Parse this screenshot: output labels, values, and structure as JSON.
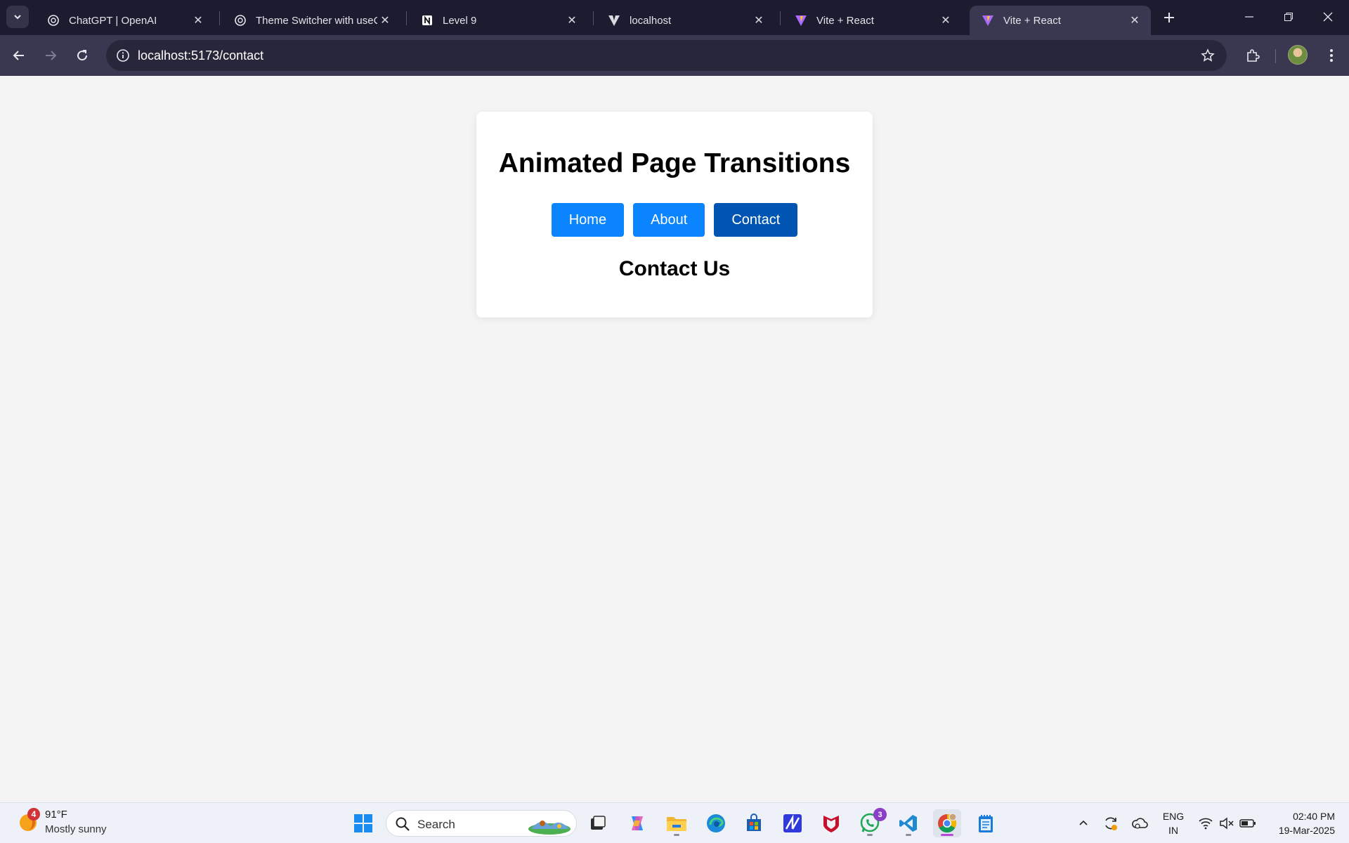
{
  "browser": {
    "tabs": [
      {
        "title": "ChatGPT | OpenAI",
        "icon": "openai-icon"
      },
      {
        "title": "Theme Switcher with useCo",
        "icon": "openai-icon"
      },
      {
        "title": "Level 9",
        "icon": "notion-icon"
      },
      {
        "title": "localhost",
        "icon": "vite-icon"
      },
      {
        "title": "Vite + React",
        "icon": "vite-icon"
      },
      {
        "title": "Vite + React",
        "icon": "vite-icon",
        "active": true
      }
    ],
    "address": "localhost:5173/contact"
  },
  "page": {
    "heading": "Animated Page Transitions",
    "nav": {
      "home": "Home",
      "about": "About",
      "contact": "Contact",
      "active": "contact"
    },
    "subheading": "Contact Us",
    "colors": {
      "button": "#0a84ff",
      "button_active": "#0055b3",
      "background": "#f4f4f4"
    }
  },
  "taskbar": {
    "weather": {
      "temp": "91°F",
      "desc": "Mostly sunny",
      "badge": "4"
    },
    "search_label": "Search",
    "whatsapp_badge": "3",
    "lang_line1": "ENG",
    "lang_line2": "IN",
    "time": "02:40 PM",
    "date": "19-Mar-2025"
  }
}
